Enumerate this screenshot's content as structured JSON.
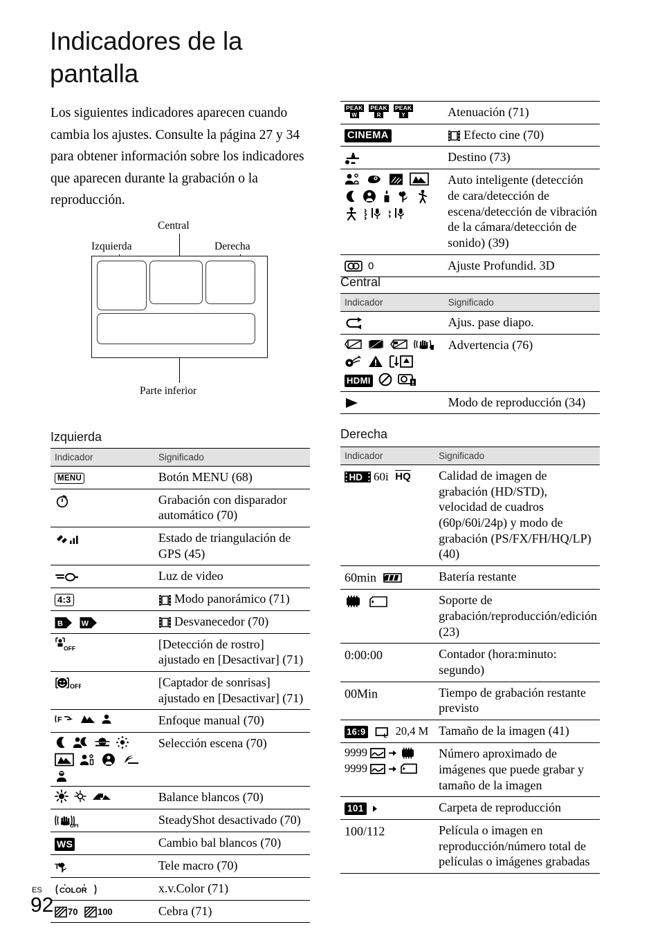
{
  "page": {
    "title": "Indicadores de la pantalla",
    "intro": "Los siguientes indicadores aparecen cuando cambia los ajustes. Consulte la página 27 y 34 para obtener información sobre los indicadores que aparecen durante la grabación o la reproducción.",
    "folio_lang": "ES",
    "folio_number": "92"
  },
  "diagram": {
    "label_central": "Central",
    "label_left": "Izquierda",
    "label_right": "Derecha",
    "label_bottom": "Parte inferior"
  },
  "columns": {
    "indicador": "Indicador",
    "significado": "Significado"
  },
  "sections": {
    "izquierda": "Izquierda",
    "central": "Central",
    "derecha": "Derecha"
  },
  "table_top_right": {
    "rows": [
      {
        "icons": "PEAK W / PEAK R / PEAK Y",
        "meaning": "Atenuación (71)"
      },
      {
        "icons": "CINEMA",
        "meaning": "Efecto cine (70)",
        "film_prefix": true
      },
      {
        "icons": "airplane-destination",
        "meaning": "Destino (73)"
      },
      {
        "icons": "intelligent-auto-set",
        "meaning": "Auto inteligente (detección de cara/detección de escena/detección de vibración de la cámara/detección de sonido) (39)"
      },
      {
        "icons": "3d-depth",
        "meaning": "Ajuste Profundid. 3D"
      }
    ]
  },
  "table_izquierda": {
    "rows": [
      {
        "icons": "MENU",
        "meaning": "Botón MENU (68)"
      },
      {
        "icons": "self-timer",
        "meaning": "Grabación con disparador automático (70)"
      },
      {
        "icons": "gps-triangulation",
        "meaning": "Estado de triangulación de GPS (45)"
      },
      {
        "icons": "video-light",
        "meaning": "Luz de video"
      },
      {
        "icons": "4:3",
        "meaning": "Modo panorámico (71)",
        "film_prefix": true
      },
      {
        "icons": "fader-b fader-w",
        "meaning": "Desvanecedor (70)",
        "film_prefix": true
      },
      {
        "icons": "face-detection-off",
        "meaning": "[Detección de rostro] ajustado en [Desactivar] (71)"
      },
      {
        "icons": "smile-shutter-off",
        "meaning": "[Captador de sonrisas] ajustado en [Desactivar] (71)"
      },
      {
        "icons": "manual-focus",
        "meaning": "Enfoque manual (70)"
      },
      {
        "icons": "scene-selection",
        "meaning": "Selección escena (70)"
      },
      {
        "icons": "white-balance",
        "meaning": "Balance blancos (70)"
      },
      {
        "icons": "steadyshot-off",
        "meaning": "SteadyShot desactivado (70)"
      },
      {
        "icons": "WS",
        "meaning": "Cambio bal blancos (70)"
      },
      {
        "icons": "tele-macro",
        "meaning": "Tele macro (70)"
      },
      {
        "icons": "x.v.Color",
        "meaning": "x.v.Color (71)"
      },
      {
        "icons": "zebra-70 zebra-100",
        "meaning": "Cebra (71)",
        "labels": [
          "70",
          "100"
        ]
      }
    ]
  },
  "table_central": {
    "rows": [
      {
        "icons": "slideshow-loop",
        "meaning": "Ajus. pase diapo."
      },
      {
        "icons": "warning-set",
        "meaning": "Advertencia (76)"
      },
      {
        "icons": "playback-triangle",
        "meaning": "Modo de reproducción (34)"
      }
    ]
  },
  "table_derecha": {
    "rows": [
      {
        "icons": "HD 60i HQ",
        "meaning": "Calidad de imagen de grabación (HD/STD), velocidad de cuadros (60p/60i/24p) y modo de grabación (PS/FX/FH/HQ/LP) (40)"
      },
      {
        "icons": "60min battery",
        "meaning": "Batería restante",
        "text": "60min"
      },
      {
        "icons": "memory-card media",
        "meaning": "Soporte de grabación/reproducción/edición (23)"
      },
      {
        "icons": "counter",
        "meaning": "Contador (hora:minuto: segundo)",
        "text": "0:00:00"
      },
      {
        "icons": "rec-time",
        "meaning": "Tiempo de grabación restante previsto",
        "text": "00Min"
      },
      {
        "icons": "16:9 L 20,4 M",
        "meaning": "Tamaño de la imagen (41)",
        "text": "20,4 M"
      },
      {
        "icons": "9999 photos",
        "meaning": "Número aproximado de imágenes que puede grabar y tamaño de la imagen",
        "text": "9999",
        "text2": "9999"
      },
      {
        "icons": "folder-101",
        "meaning": "Carpeta de reproducción",
        "text": "101"
      },
      {
        "icons": "playback-count",
        "meaning": "Película o imagen en reproducción/número total de películas o imágenes grabadas",
        "text": "100/112"
      }
    ]
  }
}
